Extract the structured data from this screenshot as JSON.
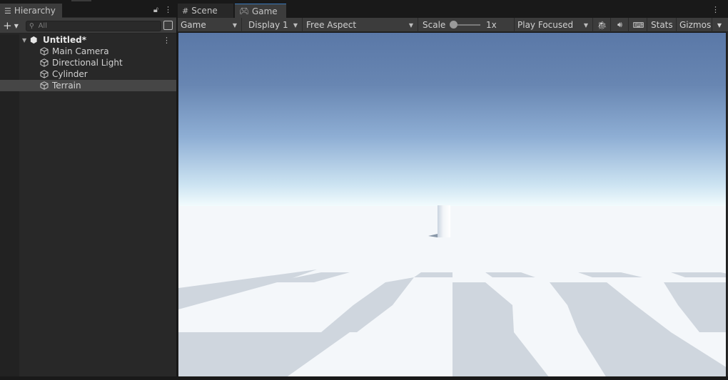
{
  "hierarchy": {
    "tab_label": "Hierarchy",
    "search_placeholder": "All",
    "scene_name": "Untitled*",
    "items": [
      {
        "label": "Main Camera"
      },
      {
        "label": "Directional Light"
      },
      {
        "label": "Cylinder"
      },
      {
        "label": "Terrain"
      }
    ],
    "selected_item": "Terrain"
  },
  "tabs": {
    "scene_label": "Scene",
    "game_label": "Game"
  },
  "game_toolbar": {
    "view_mode": "Game",
    "display": "Display 1",
    "aspect": "Free Aspect",
    "scale_label": "Scale",
    "scale_value": "1x",
    "play_mode": "Play Focused",
    "stats_label": "Stats",
    "gizmos_label": "Gizmos"
  },
  "icons": {
    "hierarchy_tab": "list-icon",
    "scene_tab": "grid-icon",
    "game_tab": "gamepad-icon",
    "debug": "bug-icon",
    "audio": "speaker-icon",
    "keyboard": "keyboard-icon"
  },
  "colors": {
    "accent": "#3a79bb",
    "panel_bg": "#282828",
    "toolbar_bg": "#3c3c3c",
    "selected_row": "#464646"
  }
}
